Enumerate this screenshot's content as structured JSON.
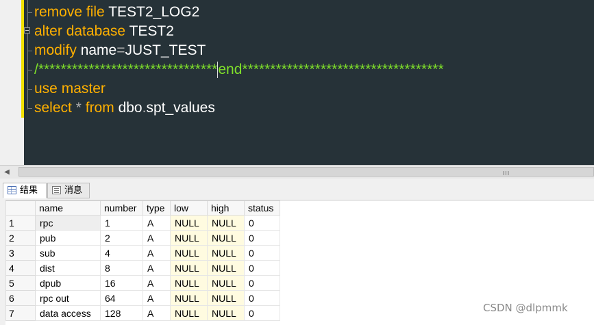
{
  "editor": {
    "lines": [
      [
        {
          "t": "remove",
          "c": "kw"
        },
        {
          "t": " ",
          "c": "wh"
        },
        {
          "t": "file",
          "c": "kw"
        },
        {
          "t": " TEST2_LOG2",
          "c": "wh"
        }
      ],
      [
        {
          "t": "alter",
          "c": "kw"
        },
        {
          "t": " ",
          "c": "wh"
        },
        {
          "t": "database",
          "c": "kw"
        },
        {
          "t": " TEST2",
          "c": "wh"
        }
      ],
      [
        {
          "t": "modify",
          "c": "kw"
        },
        {
          "t": " name",
          "c": "wh"
        },
        {
          "t": "=",
          "c": "gr"
        },
        {
          "t": "JUST_TEST",
          "c": "wh"
        }
      ],
      [
        {
          "t": "/********************************",
          "c": "cm"
        },
        {
          "t": "end",
          "c": "cm"
        },
        {
          "t": "************************************",
          "c": "cm"
        }
      ],
      [
        {
          "t": "use",
          "c": "kw"
        },
        {
          "t": " ",
          "c": "wh"
        },
        {
          "t": "master",
          "c": "kw"
        }
      ],
      [
        {
          "t": "select",
          "c": "kw"
        },
        {
          "t": " ",
          "c": "wh"
        },
        {
          "t": "*",
          "c": "gr"
        },
        {
          "t": " ",
          "c": "wh"
        },
        {
          "t": "from",
          "c": "kw"
        },
        {
          "t": " dbo",
          "c": "wh"
        },
        {
          "t": ".",
          "c": "gr"
        },
        {
          "t": "spt_values",
          "c": "wh"
        }
      ]
    ]
  },
  "scrollbar": {
    "grip": "III"
  },
  "tabs": [
    {
      "label": "结果",
      "icon": "grid-icon",
      "active": true
    },
    {
      "label": "消息",
      "icon": "message-icon",
      "active": false
    }
  ],
  "grid": {
    "columns": [
      "name",
      "number",
      "type",
      "low",
      "high",
      "status"
    ],
    "rows": [
      {
        "n": "1",
        "cells": [
          "rpc",
          "1",
          "A",
          "NULL",
          "NULL",
          "0"
        ]
      },
      {
        "n": "2",
        "cells": [
          "pub",
          "2",
          "A",
          "NULL",
          "NULL",
          "0"
        ]
      },
      {
        "n": "3",
        "cells": [
          "sub",
          "4",
          "A",
          "NULL",
          "NULL",
          "0"
        ]
      },
      {
        "n": "4",
        "cells": [
          "dist",
          "8",
          "A",
          "NULL",
          "NULL",
          "0"
        ]
      },
      {
        "n": "5",
        "cells": [
          "dpub",
          "16",
          "A",
          "NULL",
          "NULL",
          "0"
        ]
      },
      {
        "n": "6",
        "cells": [
          "rpc out",
          "64",
          "A",
          "NULL",
          "NULL",
          "0"
        ]
      },
      {
        "n": "7",
        "cells": [
          "data access",
          "128",
          "A",
          "NULL",
          "NULL",
          "0"
        ]
      }
    ]
  },
  "watermark": "CSDN @dlpmmk",
  "colors": {
    "editor_bg": "#263238",
    "keyword": "#ffb000",
    "comment": "#7fe02a",
    "null_bg": "#fffbe0"
  }
}
